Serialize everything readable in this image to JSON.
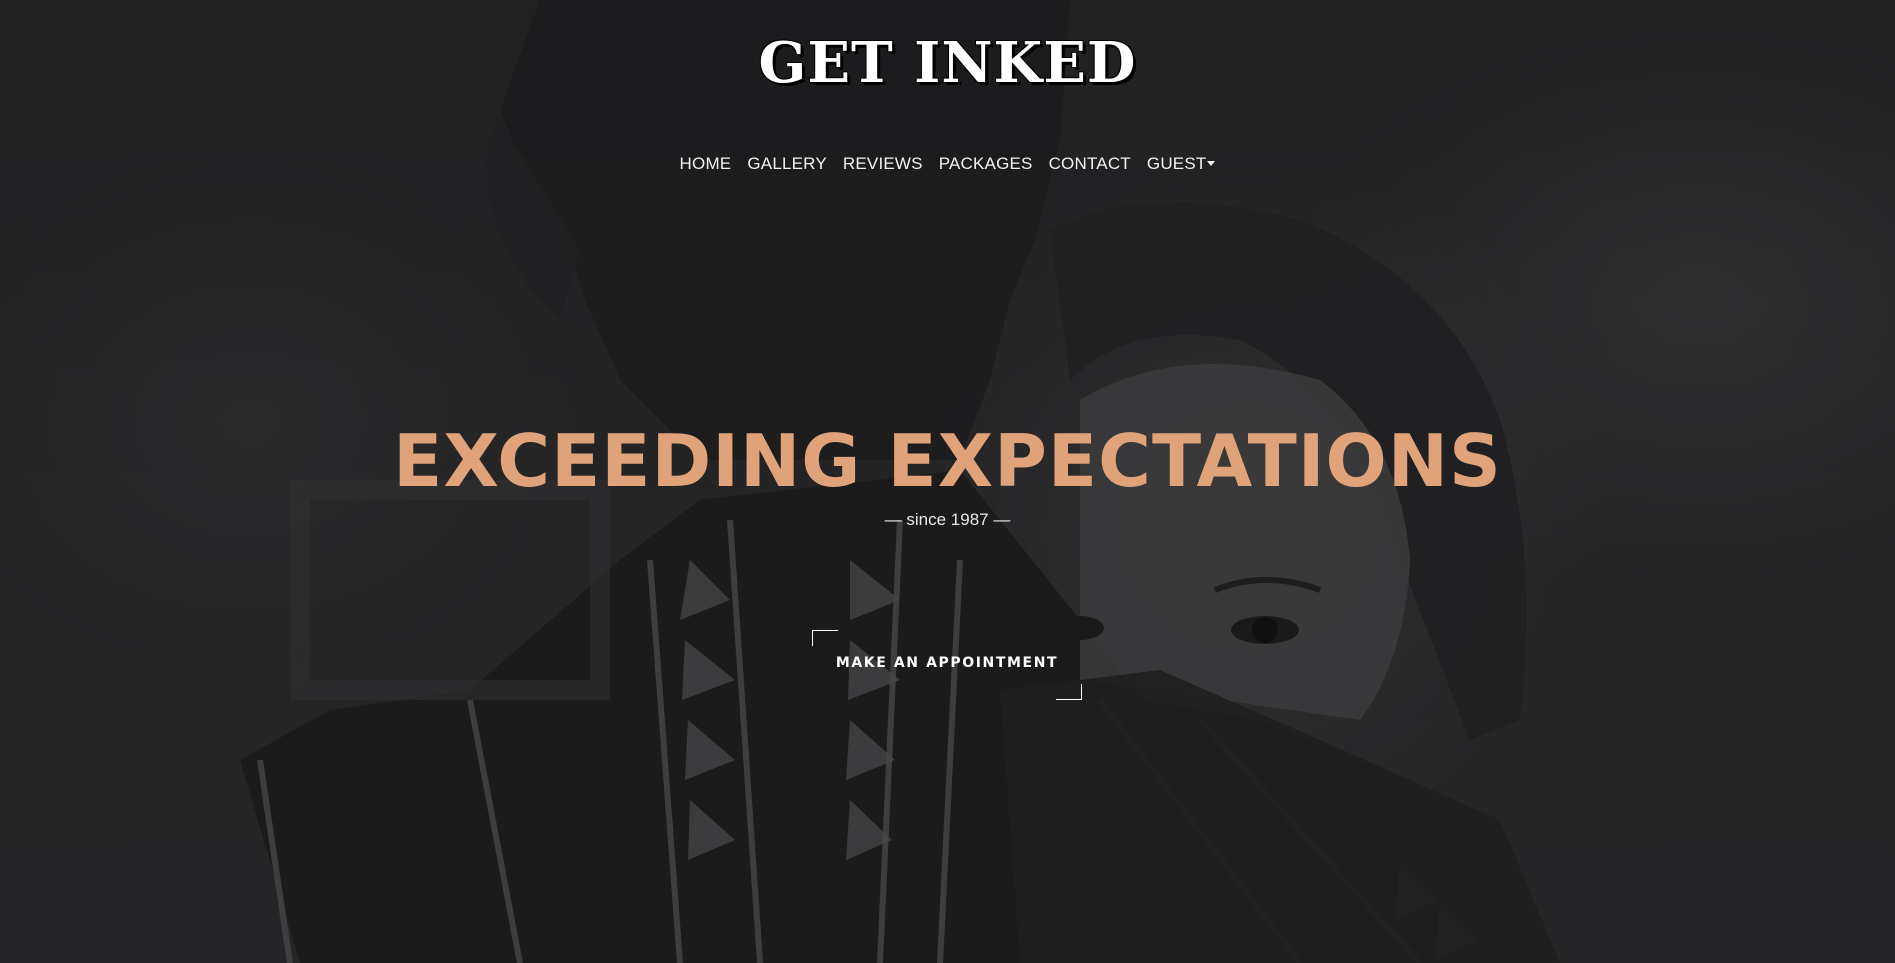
{
  "brand": {
    "logo_text": "GET INKED"
  },
  "nav": {
    "items": [
      {
        "label": "HOME"
      },
      {
        "label": "GALLERY"
      },
      {
        "label": "REVIEWS"
      },
      {
        "label": "PACKAGES"
      },
      {
        "label": "CONTACT"
      },
      {
        "label": "GUEST",
        "has_dropdown": true
      }
    ]
  },
  "hero": {
    "headline": "EXCEEDING EXPECTATIONS",
    "subline": "— since 1987 —",
    "cta_label": "MAKE AN APPOINTMENT"
  },
  "colors": {
    "accent": "#e0a278",
    "text": "#ffffff",
    "background": "#2a2a2c"
  },
  "icons": {
    "dropdown": "caret-down-icon"
  }
}
